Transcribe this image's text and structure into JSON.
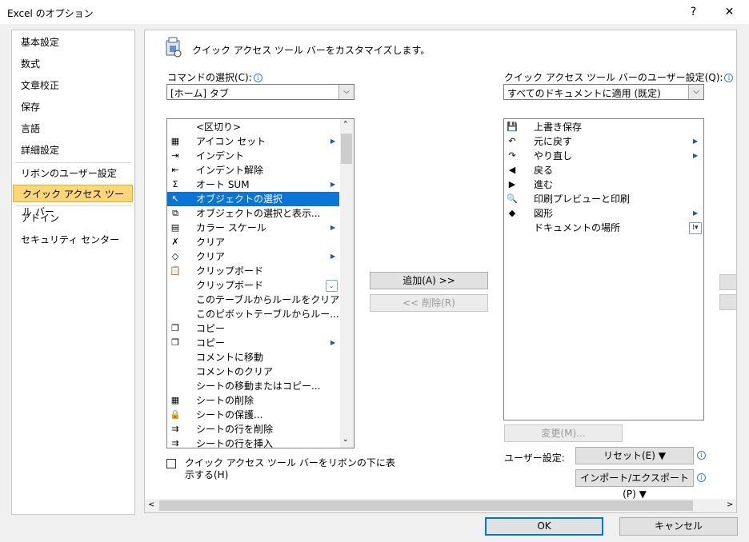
{
  "window": {
    "title": "Excel のオプション",
    "help": "?",
    "close": "✕"
  },
  "nav": {
    "items": [
      "基本設定",
      "数式",
      "文章校正",
      "保存",
      "言語",
      "詳細設定",
      "リボンのユーザー設定",
      "クイック アクセス ツール バー",
      "アドイン",
      "セキュリティ センター"
    ]
  },
  "main": {
    "heading": "クイック アクセス ツール バーをカスタマイズします。",
    "command_label": "コマンドの選択(C):",
    "command_value": "[ホーム] タブ",
    "qat_label": "クイック アクセス ツール バーのユーザー設定(Q):",
    "qat_value": "すべてのドキュメントに適用 (既定)",
    "commands": [
      {
        "label": "<区切り>",
        "icon": ""
      },
      {
        "label": "アイコン セット",
        "icon": "▦",
        "arrow": true
      },
      {
        "label": "インデント",
        "icon": "⇥"
      },
      {
        "label": "インデント解除",
        "icon": "⇤"
      },
      {
        "label": "オート SUM",
        "icon": "Σ",
        "arrow": true
      },
      {
        "label": "オブジェクトの選択",
        "icon": "↖",
        "selected": true
      },
      {
        "label": "オブジェクトの選択と表示...",
        "icon": "⧉"
      },
      {
        "label": "カラー スケール",
        "icon": "▤",
        "arrow": true
      },
      {
        "label": "クリア",
        "icon": "✗"
      },
      {
        "label": "クリア",
        "icon": "◇",
        "arrow": true
      },
      {
        "label": "クリップボード",
        "icon": "📋"
      },
      {
        "label": "クリップボード",
        "icon": "",
        "more": true
      },
      {
        "label": "このテーブルからルールをクリア",
        "icon": ""
      },
      {
        "label": "このピボットテーブルからルー...",
        "icon": ""
      },
      {
        "label": "コピー",
        "icon": "❐"
      },
      {
        "label": "コピー",
        "icon": "❐",
        "arrow": true
      },
      {
        "label": "コメントに移動",
        "icon": ""
      },
      {
        "label": "コメントのクリア",
        "icon": ""
      },
      {
        "label": "シートの移動またはコピー...",
        "icon": ""
      },
      {
        "label": "シートの削除",
        "icon": "▦"
      },
      {
        "label": "シートの保護...",
        "icon": "🔒"
      },
      {
        "label": "シートの行を削除",
        "icon": "⇉"
      },
      {
        "label": "シートの行を挿入",
        "icon": "⇉"
      }
    ],
    "qat_items": [
      {
        "label": "上書き保存",
        "icon": "💾"
      },
      {
        "label": "元に戻す",
        "icon": "↶",
        "arrow": true
      },
      {
        "label": "やり直し",
        "icon": "↷",
        "arrow": true
      },
      {
        "label": "戻る",
        "icon": "◀"
      },
      {
        "label": "進む",
        "icon": "▶"
      },
      {
        "label": "印刷プレビューと印刷",
        "icon": "🔍"
      },
      {
        "label": "図形",
        "icon": "◆",
        "arrow": true
      },
      {
        "label": "ドキュメントの場所",
        "icon": "",
        "field": true
      }
    ],
    "add_button": "追加(A) >>",
    "remove_button": "<< 削除(R)",
    "modify_button": "変更(M)...",
    "user_settings_label": "ユーザー設定:",
    "reset_button": "リセット(E) ▼",
    "import_export_button": "インポート/エクスポート(P) ▼",
    "checkbox_label_1": "クイック アクセス ツール バーをリボンの下に表",
    "checkbox_label_2": "示する(H)"
  },
  "footer": {
    "ok": "OK",
    "cancel": "キャンセル"
  },
  "colors": {
    "selection": "#0a74d8",
    "nav_selected": "#fcd777"
  }
}
